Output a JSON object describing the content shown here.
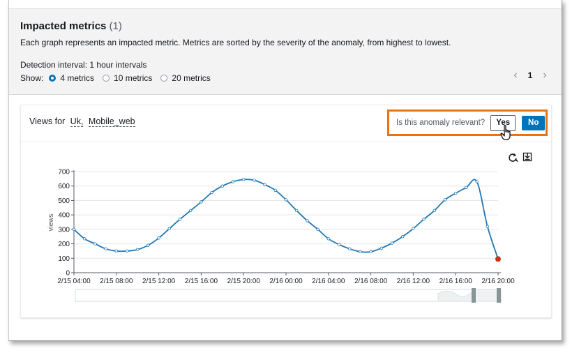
{
  "header": {
    "title": "Impacted metrics",
    "count": "(1)",
    "description": "Each graph represents an impacted metric. Metrics are sorted by the severity of the anomaly, from highest to lowest.",
    "interval_label": "Detection interval:",
    "interval_value": "1 hour intervals",
    "show_label": "Show:",
    "options": [
      "4 metrics",
      "10 metrics",
      "20 metrics"
    ],
    "selected_option": "4 metrics",
    "page": "1"
  },
  "card": {
    "views_for": "Views for",
    "dimension_1": "Uk,",
    "dimension_2": "Mobile_web",
    "relevant_question": "Is this anomaly relevant?",
    "yes_label": "Yes",
    "no_label": "No",
    "accent_color": "#ec7211",
    "primary_color": "#0073bb"
  },
  "icons": [
    "refresh-icon",
    "download-icon",
    "hand-cursor-icon",
    "chevron-left-icon",
    "chevron-right-icon"
  ],
  "chart_data": {
    "type": "line",
    "ylabel": "views",
    "ylim": [
      0,
      700
    ],
    "yticks": [
      0,
      100,
      200,
      300,
      400,
      500,
      600,
      700
    ],
    "xticks": [
      "2/15 04:00",
      "2/15 08:00",
      "2/15 12:00",
      "2/15 16:00",
      "2/15 20:00",
      "2/16 00:00",
      "2/16 04:00",
      "2/16 08:00",
      "2/16 12:00",
      "2/16 16:00",
      "2/16 20:00"
    ],
    "x_hours": [
      0,
      1,
      2,
      3,
      4,
      5,
      6,
      7,
      8,
      9,
      10,
      11,
      12,
      13,
      14,
      15,
      16,
      17,
      18,
      19,
      20,
      21,
      22,
      23,
      24,
      25,
      26,
      27,
      28,
      29,
      30,
      31,
      32,
      33,
      34,
      35,
      36,
      37,
      38,
      39,
      40
    ],
    "values": [
      300,
      235,
      200,
      165,
      150,
      150,
      160,
      190,
      240,
      305,
      370,
      430,
      490,
      555,
      600,
      630,
      645,
      640,
      610,
      570,
      505,
      430,
      360,
      300,
      235,
      195,
      165,
      145,
      145,
      170,
      205,
      250,
      305,
      370,
      430,
      505,
      550,
      590,
      630,
      320,
      95
    ],
    "anomaly_index": 40,
    "line_color": "#1f77b4",
    "anomaly_color": "#d13212",
    "grid": true
  }
}
